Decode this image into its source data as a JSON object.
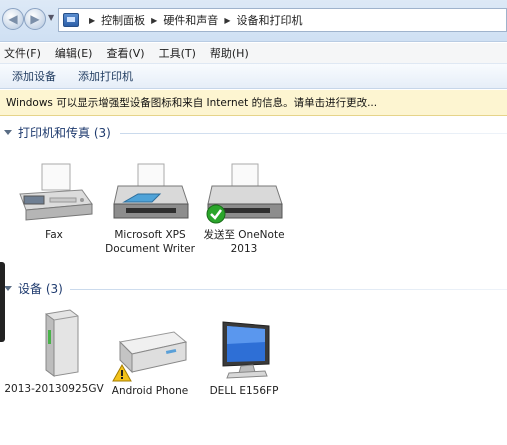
{
  "breadcrumb": [
    "控制面板",
    "硬件和声音",
    "设备和打印机"
  ],
  "menu": [
    "文件(F)",
    "编辑(E)",
    "查看(V)",
    "工具(T)",
    "帮助(H)"
  ],
  "commands": [
    "添加设备",
    "添加打印机"
  ],
  "infobar": "Windows 可以显示增强型设备图标和来自 Internet 的信息。请单击进行更改...",
  "printers_group": {
    "title": "打印机和传真 (3)"
  },
  "printers": [
    {
      "label": "Fax",
      "icon": "fax-icon"
    },
    {
      "label": "Microsoft XPS Document Writer",
      "icon": "printer-icon"
    },
    {
      "label": "发送至 OneNote 2013",
      "icon": "printer-icon",
      "badge": "default-check-icon"
    }
  ],
  "devices_group": {
    "title": "设备 (3)"
  },
  "devices": [
    {
      "label": "2013-20130925GV",
      "icon": "computer-tower-icon"
    },
    {
      "label": "Android Phone",
      "icon": "drive-icon",
      "badge": "warning-icon"
    },
    {
      "label": "DELL E156FP",
      "icon": "monitor-icon"
    }
  ],
  "colors": {
    "header_text": "#1e3a6e",
    "infobar_bg": "#fdf5d1",
    "check": "#2aa52a",
    "warning": "#f2c21b"
  }
}
